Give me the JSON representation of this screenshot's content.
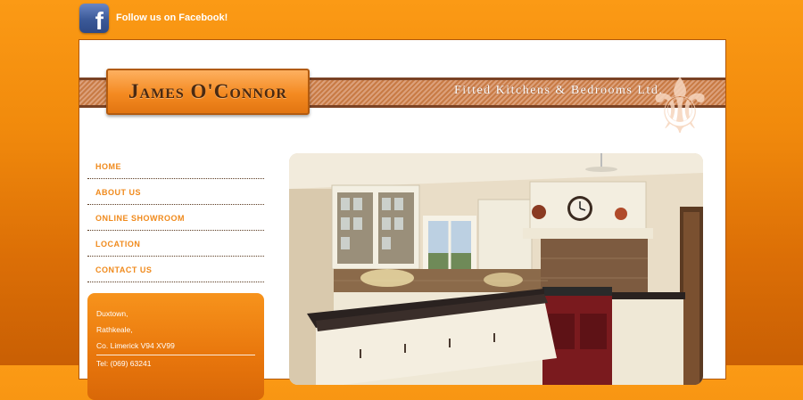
{
  "facebook": {
    "icon": "facebook-icon",
    "label": "Follow us on Facebook!",
    "glyph": "f"
  },
  "header": {
    "logo_text": "James O'Connor",
    "tagline": "Fitted Kitchens & Bedrooms Ltd.",
    "decoration": "fleur-de-lis-icon"
  },
  "nav": {
    "items": [
      {
        "label": "HOME"
      },
      {
        "label": "ABOUT US"
      },
      {
        "label": "ONLINE SHOWROOM"
      },
      {
        "label": "LOCATION"
      },
      {
        "label": "CONTACT US"
      }
    ]
  },
  "address": {
    "line1": "Duxtown,",
    "line2": "Rathkeale,",
    "line3": "Co. Limerick V94 XV99",
    "phone": "Tel: (069) 63241"
  },
  "colors": {
    "accent": "#f08a1c",
    "brand_brown": "#7a4224",
    "facebook_blue": "#3b5998"
  }
}
